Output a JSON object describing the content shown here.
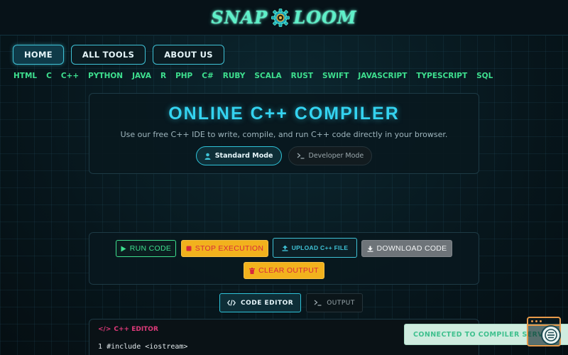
{
  "brand": {
    "left": "SNAP",
    "right": "LOOM"
  },
  "nav": [
    {
      "label": "HOME",
      "active": true
    },
    {
      "label": "ALL TOOLS",
      "active": false
    },
    {
      "label": "ABOUT US",
      "active": false
    }
  ],
  "languages": [
    "HTML",
    "C",
    "C++",
    "PYTHON",
    "JAVA",
    "R",
    "PHP",
    "C#",
    "RUBY",
    "SCALA",
    "RUST",
    "SWIFT",
    "JAVASCRIPT",
    "TYPESCRIPT",
    "SQL"
  ],
  "hero": {
    "title": "ONLINE C++ COMPILER",
    "subtitle": "Use our free C++ IDE to write, compile, and run C++ code directly in your browser.",
    "modes": {
      "standard": "Standard Mode",
      "developer": "Developer Mode"
    }
  },
  "actions": {
    "run": "RUN CODE",
    "stop": "STOP EXECUTION",
    "upload": "UPLOAD C++ FILE",
    "download": "DOWNLOAD CODE",
    "clear": "CLEAR OUTPUT"
  },
  "tabs": {
    "editor": "CODE EDITOR",
    "output": "OUTPUT"
  },
  "editor": {
    "label": "C++ EDITOR",
    "line_number": "1",
    "first_line": "#include <iostream>"
  },
  "toast": {
    "message": "CONNECTED TO COMPILER SERVER"
  },
  "colors": {
    "accent_cyan": "#34d3f0",
    "accent_green": "#3ee08f",
    "warning_yellow": "#f2b21d",
    "danger_red": "#d7293c",
    "editor_pink": "#e03a7a"
  },
  "icons": {
    "run": "play-icon",
    "stop": "stop-icon",
    "upload": "upload-icon",
    "download": "download-icon",
    "clear": "trash-icon",
    "standard_mode": "user-icon",
    "developer_mode": "terminal-icon",
    "code_editor": "code-icon",
    "output": "terminal-icon",
    "logo": "gear-icon"
  }
}
